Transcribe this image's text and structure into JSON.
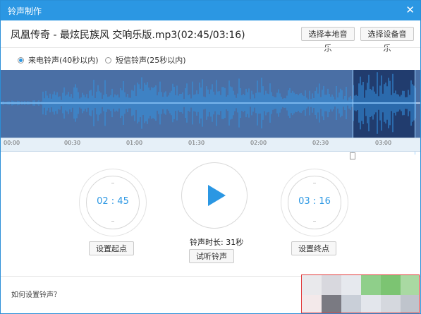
{
  "window": {
    "title": "铃声制作",
    "close_glyph": "✕"
  },
  "file": {
    "title": "凤凰传奇 - 最炫民族风 交响乐版.mp3(02:45/03:16)",
    "choose_local_label": "选择本地音乐",
    "choose_device_label": "选择设备音乐"
  },
  "ringtone_type": {
    "options": [
      {
        "label": "来电铃声(40秒以内)",
        "checked": true
      },
      {
        "label": "短信铃声(25秒以内)",
        "checked": false
      }
    ]
  },
  "timeline": {
    "ticks": [
      "00:00",
      "00:30",
      "01:00",
      "01:30",
      "02:00",
      "02:30",
      "03:00"
    ],
    "selection_start": "02:45",
    "selection_end": "03:16",
    "total": "03:16"
  },
  "start_point": {
    "time": "02 : 45",
    "button_label": "设置起点"
  },
  "end_point": {
    "time": "03 : 16",
    "button_label": "设置终点"
  },
  "preview": {
    "duration_text": "铃声时长: 31秒",
    "button_label": "试听铃声",
    "play_icon": "play-icon"
  },
  "help": {
    "text": "如何设置铃声？"
  },
  "colors": {
    "accent": "#2b97e3",
    "waveform_bg": "#4a6fa5",
    "waveform_selected": "#213c6e",
    "annotation_box": "#e23c3c"
  }
}
